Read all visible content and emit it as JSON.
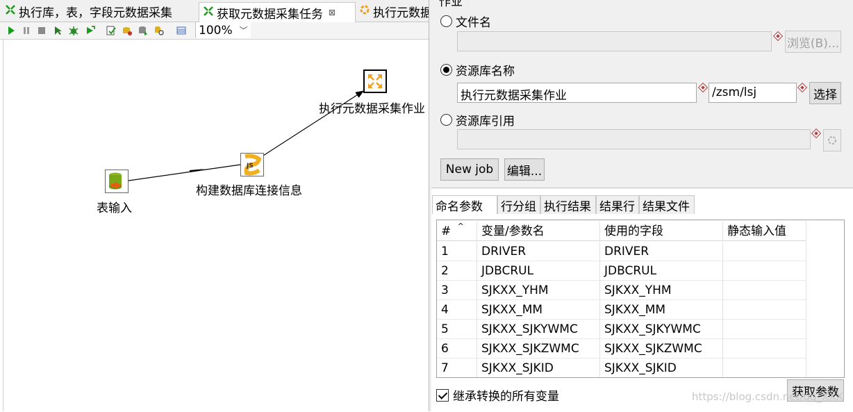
{
  "editor": {
    "tabs": [
      {
        "label": "执行库，表，字段元数据采集",
        "icon": "transformation-icon"
      },
      {
        "label": "获取元数据采集任务",
        "icon": "transformation-icon",
        "active": true
      },
      {
        "label": "执行元数据",
        "icon": "job-icon"
      }
    ],
    "zoom": "100%",
    "steps": {
      "table_input": "表输入",
      "build_conn": "构建数据库连接信息",
      "exec_job": "执行元数据采集作业"
    }
  },
  "dialog": {
    "section_title": "作业",
    "file_name_radio": "文件名",
    "browse_button": "浏览(B)...",
    "repo_name_radio": "资源库名称",
    "job_name_value": "执行元数据采集作业",
    "directory_value": "/zsm/lsj",
    "select_button": "选择",
    "repo_ref_radio": "资源库引用",
    "new_job_button": "New job",
    "edit_button": "编辑...",
    "tabs": [
      "命名参数",
      "行分组",
      "执行结果",
      "结果行",
      "结果文件"
    ],
    "table": {
      "headers": [
        "#",
        "变量/参数名",
        "使用的字段",
        "静态输入值"
      ],
      "rows": [
        [
          "1",
          "DRIVER",
          "DRIVER",
          ""
        ],
        [
          "2",
          "JDBCRUL",
          "JDBCRUL",
          ""
        ],
        [
          "3",
          "SJKXX_YHM",
          "SJKXX_YHM",
          ""
        ],
        [
          "4",
          "SJKXX_MM",
          "SJKXX_MM",
          ""
        ],
        [
          "5",
          "SJKXX_SJKYWMC",
          "SJKXX_SJKYWMC",
          ""
        ],
        [
          "6",
          "SJKXX_SJKZWMC",
          "SJKXX_SJKZWMC",
          ""
        ],
        [
          "7",
          "SJKXX_SJKID",
          "SJKXX_SJKID",
          ""
        ]
      ]
    },
    "inherit_checkbox": "继承转换的所有变量",
    "get_params_button": "获取参数",
    "watermark": "https://blog.csdn.net/qq_XXX"
  },
  "colors": {
    "accent_orange": "#f0a020",
    "run_green": "#1a9a1a"
  }
}
